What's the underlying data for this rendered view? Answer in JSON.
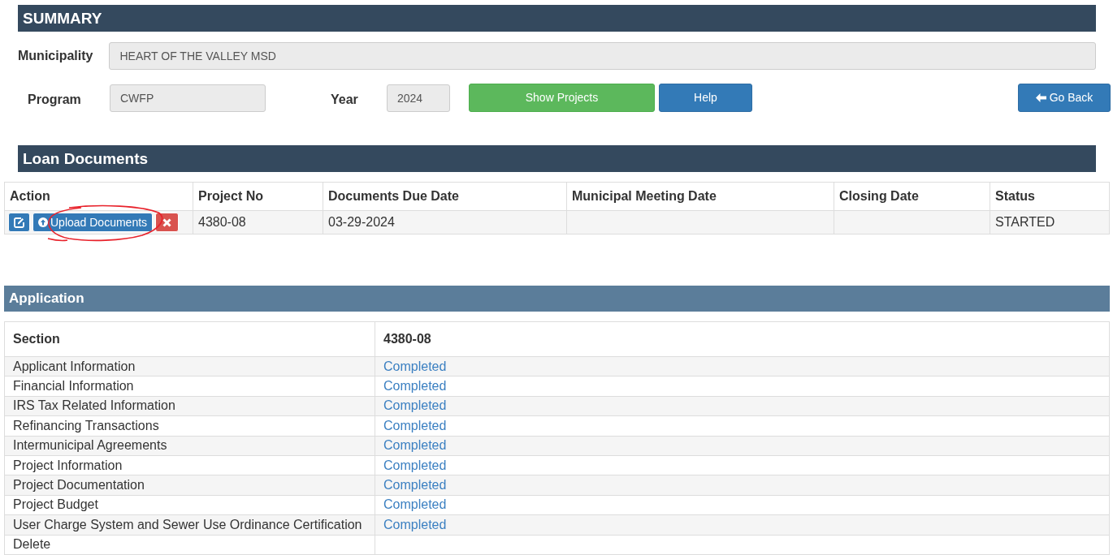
{
  "summary": {
    "title": "SUMMARY",
    "municipality": {
      "label": "Municipality",
      "value": "HEART OF THE VALLEY MSD"
    },
    "program": {
      "label": "Program",
      "value": "CWFP"
    },
    "year": {
      "label": "Year",
      "value": "2024"
    },
    "buttons": [
      {
        "label": "Show Projects",
        "kind": "success"
      },
      {
        "label": "Help",
        "kind": "primary"
      }
    ],
    "back_button": {
      "label": "Go Back"
    }
  },
  "loan_documents": {
    "title": "Loan Documents",
    "columns": [
      "Action",
      "Project No",
      "Documents Due Date",
      "Municipal Meeting Date",
      "Closing Date",
      "Status"
    ],
    "rows": [
      {
        "upload_label": "Upload Documents",
        "project_no": "4380-08",
        "due_date": "03-29-2024",
        "meeting_date": "",
        "closing_date": "",
        "status": "STARTED",
        "annotated": true
      }
    ]
  },
  "application": {
    "title": "Application",
    "columns": [
      "Section",
      "4380-08"
    ],
    "rows": [
      {
        "section": "Applicant Information",
        "state": "Completed"
      },
      {
        "section": "Financial Information",
        "state": "Completed"
      },
      {
        "section": "IRS Tax Related Information",
        "state": "Completed"
      },
      {
        "section": "Refinancing Transactions",
        "state": "Completed"
      },
      {
        "section": "Intermunicipal Agreements",
        "state": "Completed"
      },
      {
        "section": "Project Information",
        "state": "Completed"
      },
      {
        "section": "Project Documentation",
        "state": "Completed"
      },
      {
        "section": "Project Budget",
        "state": "Completed"
      },
      {
        "section": "User Charge System and Sewer Use Ordinance Certification",
        "state": "Completed"
      },
      {
        "section": "Delete",
        "state": ""
      }
    ]
  }
}
